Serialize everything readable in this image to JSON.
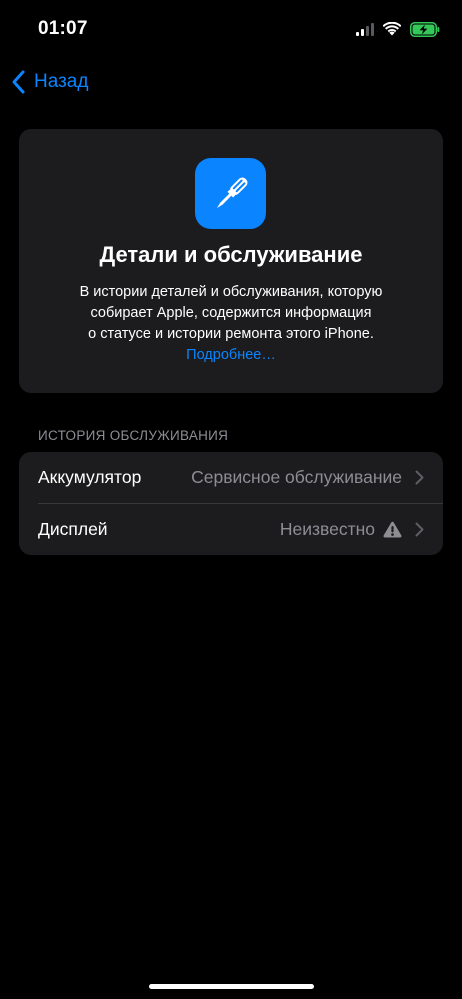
{
  "status_bar": {
    "time": "01:07"
  },
  "nav": {
    "back_label": "Назад"
  },
  "info_card": {
    "title": "Детали и обслуживание",
    "description_lines": [
      "В истории деталей и обслуживания, которую",
      "собирает Apple, содержится информация",
      "о статусе и истории ремонта этого iPhone."
    ],
    "learn_more": "Подробнее…",
    "icon": "screwdriver-icon"
  },
  "service_history": {
    "header": "ИСТОРИЯ ОБСЛУЖИВАНИЯ",
    "rows": [
      {
        "label": "Аккумулятор",
        "value": "Сервисное обслуживание",
        "icon": "chevron-right-icon"
      },
      {
        "label": "Дисплей",
        "value": "Неизвестно",
        "status_icon": "warning-icon",
        "icon": "chevron-right-icon"
      }
    ]
  },
  "colors": {
    "background": "#000000",
    "card": "#1c1c1e",
    "accent": "#0a84ff",
    "secondary_text": "#8d8d93",
    "battery_charging": "#34c759"
  }
}
